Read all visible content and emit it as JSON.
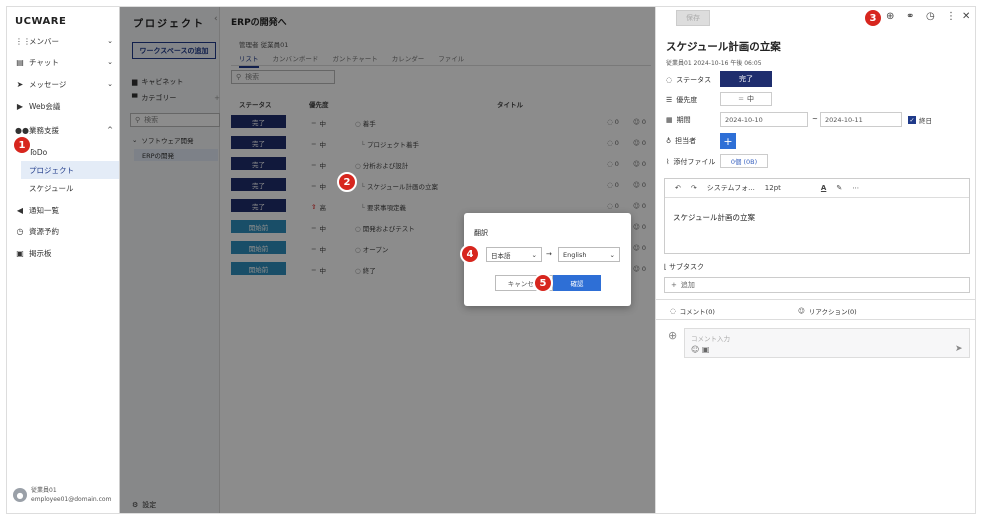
{
  "sidebar": {
    "logo": "UCWARE",
    "items": [
      {
        "icon": "org",
        "label": "メンバー",
        "chev": "⌄"
      },
      {
        "icon": "chat",
        "label": "チャット",
        "chev": "⌄"
      },
      {
        "icon": "send",
        "label": "メッセージ",
        "chev": "⌄"
      },
      {
        "icon": "video",
        "label": "Web会議",
        "chev": ""
      },
      {
        "icon": "people",
        "label": "業務支援",
        "chev": "^"
      }
    ],
    "sub_items": [
      "ToDo",
      "プロジェクト",
      "スケジュール"
    ],
    "items2": [
      {
        "icon": "megaphone",
        "label": "通知一覧"
      },
      {
        "icon": "clock",
        "label": "資源予約"
      },
      {
        "icon": "board",
        "label": "掲示板"
      }
    ],
    "user_name": "従業員01",
    "user_email": "employee01@domain.com"
  },
  "projects": {
    "title": "プロジェクト",
    "add_workspace": "ワークスペースの追加",
    "cabinet": "キャビネット",
    "category": "カテゴリー",
    "search_placeholder": "検索",
    "group": "ソフトウェア開発",
    "project": "ERPの開発",
    "settings": "設定"
  },
  "main": {
    "title": "ERPの開発へ",
    "manager": "管理者 従業員01",
    "tabs": [
      "リスト",
      "カンバンボード",
      "ガントチャート",
      "カレンダー",
      "ファイル"
    ],
    "search_placeholder": "検索",
    "headers": {
      "status": "ステータス",
      "priority": "優先度",
      "title": "タイトル"
    },
    "rows": [
      {
        "status": "完了",
        "type": "done",
        "priority": "中",
        "title": "着手",
        "c1": "0",
        "c2": "0"
      },
      {
        "status": "完了",
        "type": "done",
        "priority": "中",
        "title": "プロジェクト着手",
        "c1": "0",
        "c2": "0"
      },
      {
        "status": "完了",
        "type": "done",
        "priority": "中",
        "title": "分析および設計",
        "c1": "0",
        "c2": "0"
      },
      {
        "status": "完了",
        "type": "done",
        "priority": "中",
        "title": "スケジュール計画の立案",
        "c1": "0",
        "c2": "0"
      },
      {
        "status": "完了",
        "type": "done",
        "priority": "高",
        "title": "要求事項定義",
        "c1": "0",
        "c2": "0"
      },
      {
        "status": "開始前",
        "type": "open",
        "priority": "中",
        "title": "開発およびテスト",
        "c1": "0",
        "c2": "0"
      },
      {
        "status": "開始前",
        "type": "open",
        "priority": "中",
        "title": "オープン",
        "c1": "0",
        "c2": "0"
      },
      {
        "status": "開始前",
        "type": "open",
        "priority": "中",
        "title": "終了",
        "c1": "0",
        "c2": "0"
      }
    ]
  },
  "detail": {
    "save": "保存",
    "title": "スケジュール計画の立案",
    "sub": "従業員01 2024-10-16 午後 06:05",
    "status_label": "ステータス",
    "status_value": "完了",
    "priority_label": "優先度",
    "priority_value": "中",
    "period_label": "期間",
    "date_start": "2024-10-10",
    "date_end": "2024-10-11",
    "tilde": "~",
    "allday": "終日",
    "assignee_label": "担当者",
    "attach_label": "添付ファイル",
    "attach_value": "0個 (0B)",
    "toolbar_font": "システムフォ...",
    "toolbar_size": "12pt",
    "body": "スケジュール計画の立案",
    "subtask": "サブタスク",
    "add": "追加",
    "comments": "コメント(0)",
    "reactions": "リアクション(0)",
    "comment_placeholder": "コメント入力"
  },
  "dialog": {
    "title": "翻訳",
    "from": "日本語",
    "arrow": "→",
    "to": "English",
    "cancel": "キャンセル",
    "confirm": "確認"
  },
  "markers": [
    "1",
    "2",
    "3",
    "4",
    "5"
  ]
}
